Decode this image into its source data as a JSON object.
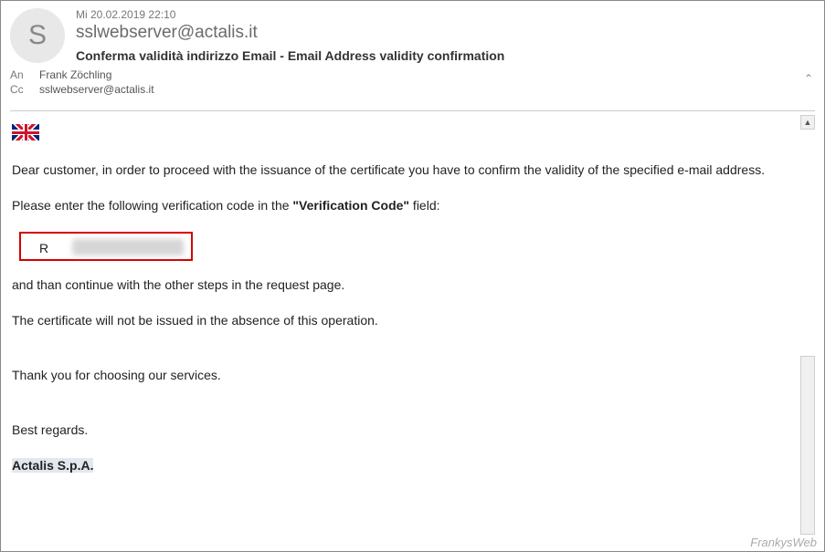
{
  "header": {
    "timestamp": "Mi 20.02.2019 22:10",
    "sender": "sslwebserver@actalis.it",
    "subject": "Conferma validità indirizzo Email - Email Address validity confirmation",
    "avatar_initial": "S"
  },
  "recipients": {
    "to_label": "An",
    "to_value": "Frank Zöchling",
    "cc_label": "Cc",
    "cc_value": "sslwebserver@actalis.it"
  },
  "body": {
    "greeting": "Dear customer, in order to proceed with the issuance of the certificate you have to confirm the validity of the specified e-mail address.",
    "instruction_prefix": "Please enter the following verification code in the ",
    "instruction_bold": "\"Verification Code\"",
    "instruction_suffix": " field:",
    "code_visible_char": "R",
    "continue_text": "and than continue with the other steps in the request page.",
    "warning_text": "The certificate will not be issued in the absence of this operation.",
    "thanks_text": "Thank you for choosing our services.",
    "regards_text": "Best regards.",
    "company": "Actalis S.p.A."
  },
  "watermark": "FrankysWeb"
}
